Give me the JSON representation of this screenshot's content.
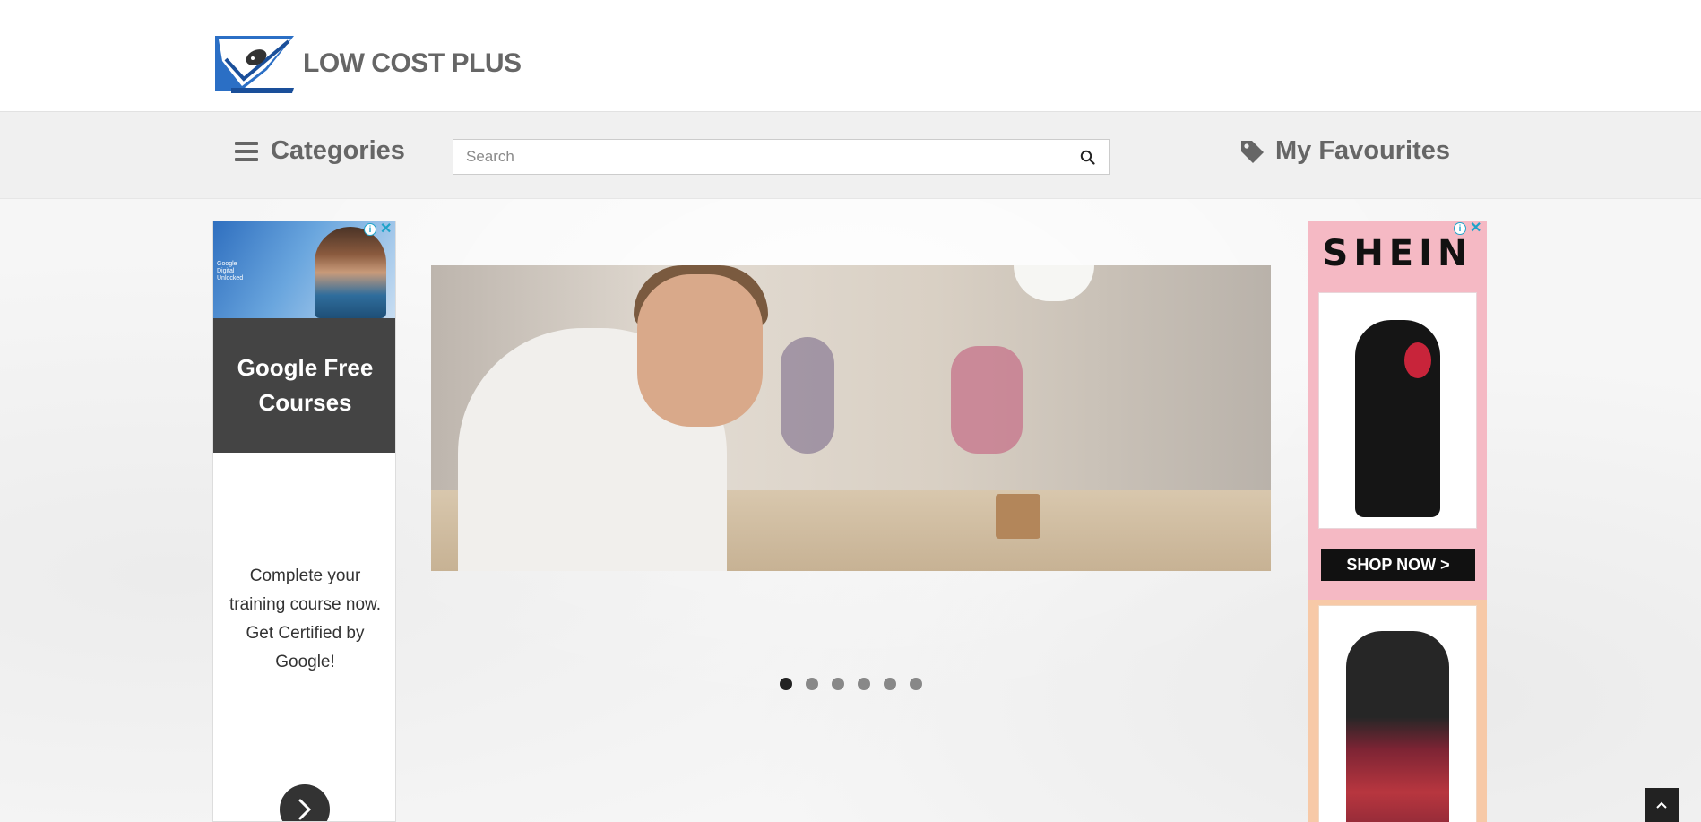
{
  "header": {
    "logo_text": "LOW COST PLUS"
  },
  "navbar": {
    "categories_label": "Categories",
    "search_placeholder": "Search",
    "favourites_label": "My Favourites"
  },
  "ad_left": {
    "image_caption": "Google Digital Unlocked",
    "title": "Google Free Courses",
    "body": "Complete your training course now. Get Certified by Google!",
    "adchoices_icon": "info-icon",
    "close_icon": "close-icon"
  },
  "carousel": {
    "slide_count": 6,
    "active_slide": 1
  },
  "ad_right": {
    "brand": "SHEIN",
    "cta": "SHOP NOW >",
    "adchoices_icon": "info-icon",
    "close_icon": "close-icon"
  },
  "colors": {
    "header_bg": "#ffffff",
    "navbar_bg": "#f0f0f0",
    "nav_text": "#666666",
    "ad_dark": "#444444",
    "shein_pink": "#f5b9c4"
  }
}
